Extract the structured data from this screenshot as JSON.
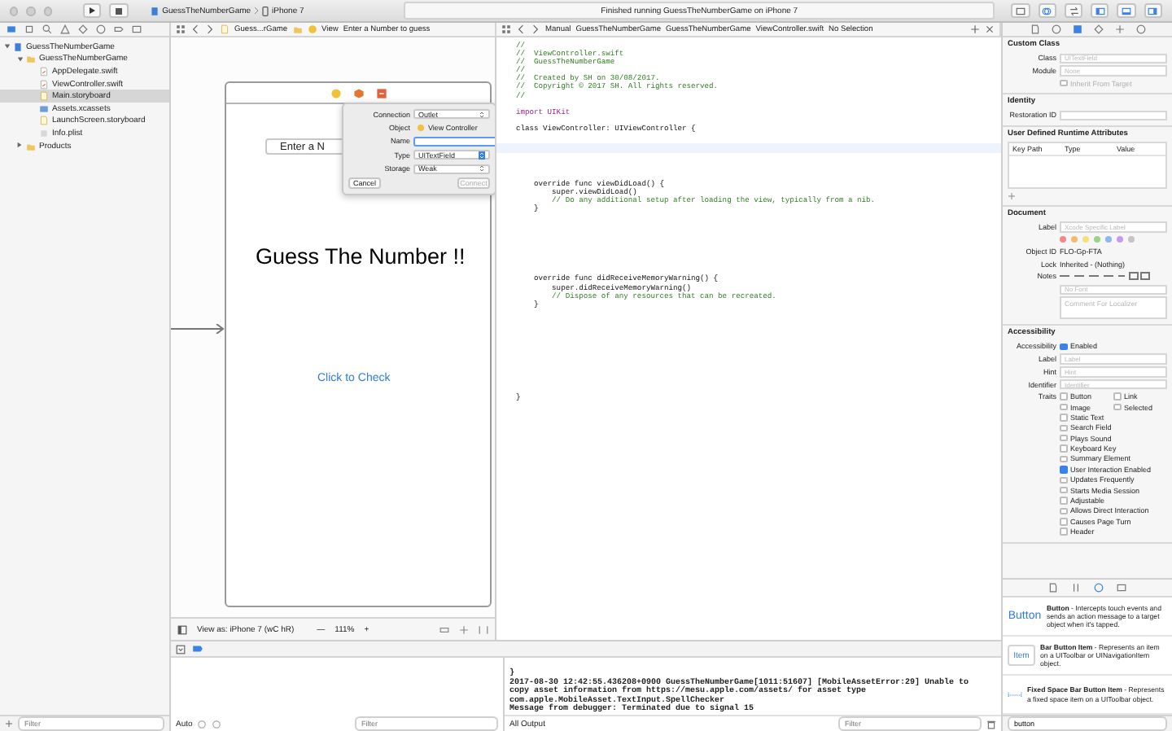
{
  "toolbar": {
    "scheme": "GuessTheNumberGame",
    "device": "iPhone 7",
    "status": "Finished running GuessTheNumberGame on iPhone 7"
  },
  "canvas_jump_bar": [
    "Guess...rGame",
    "View",
    "Enter a Number to guess"
  ],
  "editor_jump_bar": {
    "mode": "Manual",
    "path": [
      "GuessTheNumberGame",
      "GuessTheNumberGame",
      "ViewController.swift",
      "No Selection"
    ]
  },
  "navigator": {
    "tree": [
      {
        "label": "GuessTheNumberGame",
        "kind": "project",
        "expanded": true,
        "selected": false,
        "children": [
          {
            "label": "GuessTheNumberGame",
            "kind": "folder",
            "expanded": true,
            "selected": false,
            "children": [
              {
                "label": "AppDelegate.swift",
                "kind": "swift",
                "selected": false
              },
              {
                "label": "ViewController.swift",
                "kind": "swift",
                "selected": false
              },
              {
                "label": "Main.storyboard",
                "kind": "storyboard",
                "selected": true
              },
              {
                "label": "Assets.xcassets",
                "kind": "assets",
                "selected": false
              },
              {
                "label": "LaunchScreen.storyboard",
                "kind": "storyboard",
                "selected": false
              },
              {
                "label": "Info.plist",
                "kind": "plist",
                "selected": false
              }
            ]
          },
          {
            "label": "Products",
            "kind": "folder",
            "expanded": false,
            "selected": false
          }
        ]
      }
    ],
    "filter_placeholder": "Filter"
  },
  "scene": {
    "text_field": "Enter a N",
    "title": "Guess The Number !!",
    "button": "Click to Check"
  },
  "connection_popup": {
    "rows": [
      {
        "label": "Connection",
        "kind": "select",
        "value": "Outlet"
      },
      {
        "label": "Object",
        "kind": "object",
        "value": "View Controller"
      },
      {
        "label": "Name",
        "kind": "input"
      },
      {
        "label": "Type",
        "kind": "combo",
        "value": "UITextField"
      },
      {
        "label": "Storage",
        "kind": "select",
        "value": "Weak"
      }
    ],
    "buttons": [
      {
        "label": "Cancel",
        "disabled": false
      },
      {
        "label": "Connect",
        "disabled": true
      }
    ]
  },
  "canvas_bar": {
    "device": "View as: iPhone 7 (wC hR)",
    "zoom_out": "—",
    "zoom": "111%",
    "zoom_in": "+"
  },
  "code_blocks": [
    {
      "lines": [
        {
          "text": "//",
          "kind": "comment"
        },
        {
          "text": "//  ViewController.swift",
          "kind": "comment"
        },
        {
          "text": "//  GuessTheNumberGame",
          "kind": "comment"
        },
        {
          "text": "//",
          "kind": "comment"
        },
        {
          "text": "//  Created by SH on 30/08/2017.",
          "kind": "comment"
        },
        {
          "text": "//  Copyright © 2017 SH. All rights reserved.",
          "kind": "comment"
        },
        {
          "text": "//",
          "kind": "comment"
        }
      ]
    },
    {
      "lines": [
        {
          "text": "import UIKit",
          "kind": "keyword"
        }
      ]
    },
    {
      "lines": [
        {
          "text": "class ViewController: UIViewController {",
          "kind": "code"
        }
      ]
    },
    {
      "lines": [
        {
          "text": "    override func viewDidLoad() {",
          "kind": "code"
        },
        {
          "text": "        super.viewDidLoad()",
          "kind": "code"
        },
        {
          "text": "        // Do any additional setup after loading the view, typically from a nib.",
          "kind": "comment"
        },
        {
          "text": "    }",
          "kind": "code"
        }
      ]
    },
    {
      "lines": [
        {
          "text": "    override func didReceiveMemoryWarning() {",
          "kind": "code"
        },
        {
          "text": "        super.didReceiveMemoryWarning()",
          "kind": "code"
        },
        {
          "text": "        // Dispose of any resources that can be recreated.",
          "kind": "comment"
        },
        {
          "text": "    }",
          "kind": "code"
        }
      ]
    },
    {
      "lines": [
        {
          "text": "}",
          "kind": "code"
        }
      ]
    }
  ],
  "debug": {
    "scope": "Auto",
    "filter_placeholder": "Filter",
    "console_lines": [
      "}",
      "2017-08-30 12:42:55.436208+0900 GuessTheNumberGame[1011:51607] [MobileAssetError:29] Unable to",
      "copy asset information from https://mesu.apple.com/assets/ for asset type",
      "com.apple.MobileAsset.TextInput.SpellChecker",
      "Message from debugger: Terminated due to signal 15"
    ],
    "output": "All Output",
    "console_filter_placeholder": "Filter"
  },
  "inspector": {
    "custom_class": {
      "title": "Custom Class",
      "class_label": "Class",
      "class_placeholder": "UITextField",
      "module_label": "Module",
      "module_placeholder": "None",
      "inherit": "Inherit From Target",
      "inherit_checked": false,
      "inherit_disabled": true
    },
    "identity": {
      "title": "Identity",
      "restoration_label": "Restoration ID"
    },
    "runtime_attributes": {
      "title": "User Defined Runtime Attributes",
      "columns": [
        "Key Path",
        "Type",
        "Value"
      ]
    },
    "document": {
      "title": "Document",
      "label_label": "Label",
      "label_placeholder": "Xcode Specific Label",
      "object_id_label": "Object ID",
      "object_id": "FLO-Gp-FTA",
      "lock_label": "Lock",
      "lock": "Inherited - (Nothing)",
      "notes_label": "Notes",
      "font_placeholder": "No Font",
      "comment_placeholder": "Comment For Localizer"
    },
    "accessibility": {
      "title": "Accessibility",
      "enabled_label": "Accessibility",
      "enabled_text": "Enabled",
      "enabled": true,
      "fields": [
        {
          "label": "Label",
          "placeholder": "Label"
        },
        {
          "label": "Hint",
          "placeholder": "Hint"
        },
        {
          "label": "Identifier",
          "placeholder": "Identifier"
        }
      ],
      "traits_label": "Traits",
      "traits": [
        {
          "label": "Button",
          "checked": false
        },
        {
          "label": "Link",
          "checked": false
        },
        {
          "label": "Image",
          "checked": false
        },
        {
          "label": "Selected",
          "checked": false
        },
        {
          "label": "Static Text",
          "checked": false
        },
        {
          "label": "Search Field",
          "checked": false
        },
        {
          "label": "Plays Sound",
          "checked": false
        },
        {
          "label": "Keyboard Key",
          "checked": false
        },
        {
          "label": "Summary Element",
          "checked": false
        },
        {
          "label": "User Interaction Enabled",
          "checked": true
        },
        {
          "label": "Updates Frequently",
          "checked": false
        },
        {
          "label": "Starts Media Session",
          "checked": false
        },
        {
          "label": "Adjustable",
          "checked": false
        },
        {
          "label": "Allows Direct Interaction",
          "checked": false
        },
        {
          "label": "Causes Page Turn",
          "checked": false
        },
        {
          "label": "Header",
          "checked": false
        }
      ]
    }
  },
  "library": {
    "items": [
      {
        "kind": "button",
        "thumb": "Button",
        "description": "**Button** - Intercepts touch events and sends an action message to a target object when it's tapped."
      },
      {
        "kind": "item",
        "thumb": "Item",
        "description": "**Bar Button Item** - Represents an item on a UIToolbar or UINavigationItem object."
      },
      {
        "kind": "space",
        "description": "**Fixed Space Bar Button Item** - Represents a fixed space item on a UIToolbar object."
      }
    ],
    "filter": "button"
  }
}
